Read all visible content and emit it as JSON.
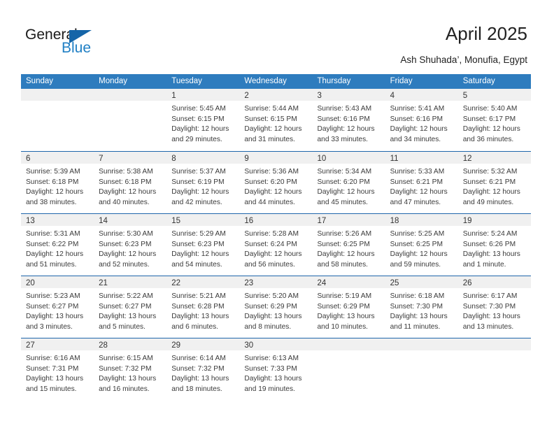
{
  "brand": {
    "name_part1": "General",
    "name_part2": "Blue",
    "triangle_color": "#1565a8",
    "blue_color": "#1f7fc4"
  },
  "header": {
    "title": "April 2025",
    "subtitle": "Ash Shuhada’, Monufia, Egypt"
  },
  "theme": {
    "header_bg": "#2e7cbe",
    "row_border": "#1f66ab",
    "date_strip_bg": "#f0f0f0"
  },
  "weekdays": [
    "Sunday",
    "Monday",
    "Tuesday",
    "Wednesday",
    "Thursday",
    "Friday",
    "Saturday"
  ],
  "weeks": [
    [
      {
        "day": "",
        "blank": true
      },
      {
        "day": "",
        "blank": true
      },
      {
        "day": "1",
        "sunrise": "Sunrise: 5:45 AM",
        "sunset": "Sunset: 6:15 PM",
        "daylight": "Daylight: 12 hours and 29 minutes."
      },
      {
        "day": "2",
        "sunrise": "Sunrise: 5:44 AM",
        "sunset": "Sunset: 6:15 PM",
        "daylight": "Daylight: 12 hours and 31 minutes."
      },
      {
        "day": "3",
        "sunrise": "Sunrise: 5:43 AM",
        "sunset": "Sunset: 6:16 PM",
        "daylight": "Daylight: 12 hours and 33 minutes."
      },
      {
        "day": "4",
        "sunrise": "Sunrise: 5:41 AM",
        "sunset": "Sunset: 6:16 PM",
        "daylight": "Daylight: 12 hours and 34 minutes."
      },
      {
        "day": "5",
        "sunrise": "Sunrise: 5:40 AM",
        "sunset": "Sunset: 6:17 PM",
        "daylight": "Daylight: 12 hours and 36 minutes."
      }
    ],
    [
      {
        "day": "6",
        "sunrise": "Sunrise: 5:39 AM",
        "sunset": "Sunset: 6:18 PM",
        "daylight": "Daylight: 12 hours and 38 minutes."
      },
      {
        "day": "7",
        "sunrise": "Sunrise: 5:38 AM",
        "sunset": "Sunset: 6:18 PM",
        "daylight": "Daylight: 12 hours and 40 minutes."
      },
      {
        "day": "8",
        "sunrise": "Sunrise: 5:37 AM",
        "sunset": "Sunset: 6:19 PM",
        "daylight": "Daylight: 12 hours and 42 minutes."
      },
      {
        "day": "9",
        "sunrise": "Sunrise: 5:36 AM",
        "sunset": "Sunset: 6:20 PM",
        "daylight": "Daylight: 12 hours and 44 minutes."
      },
      {
        "day": "10",
        "sunrise": "Sunrise: 5:34 AM",
        "sunset": "Sunset: 6:20 PM",
        "daylight": "Daylight: 12 hours and 45 minutes."
      },
      {
        "day": "11",
        "sunrise": "Sunrise: 5:33 AM",
        "sunset": "Sunset: 6:21 PM",
        "daylight": "Daylight: 12 hours and 47 minutes."
      },
      {
        "day": "12",
        "sunrise": "Sunrise: 5:32 AM",
        "sunset": "Sunset: 6:21 PM",
        "daylight": "Daylight: 12 hours and 49 minutes."
      }
    ],
    [
      {
        "day": "13",
        "sunrise": "Sunrise: 5:31 AM",
        "sunset": "Sunset: 6:22 PM",
        "daylight": "Daylight: 12 hours and 51 minutes."
      },
      {
        "day": "14",
        "sunrise": "Sunrise: 5:30 AM",
        "sunset": "Sunset: 6:23 PM",
        "daylight": "Daylight: 12 hours and 52 minutes."
      },
      {
        "day": "15",
        "sunrise": "Sunrise: 5:29 AM",
        "sunset": "Sunset: 6:23 PM",
        "daylight": "Daylight: 12 hours and 54 minutes."
      },
      {
        "day": "16",
        "sunrise": "Sunrise: 5:28 AM",
        "sunset": "Sunset: 6:24 PM",
        "daylight": "Daylight: 12 hours and 56 minutes."
      },
      {
        "day": "17",
        "sunrise": "Sunrise: 5:26 AM",
        "sunset": "Sunset: 6:25 PM",
        "daylight": "Daylight: 12 hours and 58 minutes."
      },
      {
        "day": "18",
        "sunrise": "Sunrise: 5:25 AM",
        "sunset": "Sunset: 6:25 PM",
        "daylight": "Daylight: 12 hours and 59 minutes."
      },
      {
        "day": "19",
        "sunrise": "Sunrise: 5:24 AM",
        "sunset": "Sunset: 6:26 PM",
        "daylight": "Daylight: 13 hours and 1 minute."
      }
    ],
    [
      {
        "day": "20",
        "sunrise": "Sunrise: 5:23 AM",
        "sunset": "Sunset: 6:27 PM",
        "daylight": "Daylight: 13 hours and 3 minutes."
      },
      {
        "day": "21",
        "sunrise": "Sunrise: 5:22 AM",
        "sunset": "Sunset: 6:27 PM",
        "daylight": "Daylight: 13 hours and 5 minutes."
      },
      {
        "day": "22",
        "sunrise": "Sunrise: 5:21 AM",
        "sunset": "Sunset: 6:28 PM",
        "daylight": "Daylight: 13 hours and 6 minutes."
      },
      {
        "day": "23",
        "sunrise": "Sunrise: 5:20 AM",
        "sunset": "Sunset: 6:29 PM",
        "daylight": "Daylight: 13 hours and 8 minutes."
      },
      {
        "day": "24",
        "sunrise": "Sunrise: 5:19 AM",
        "sunset": "Sunset: 6:29 PM",
        "daylight": "Daylight: 13 hours and 10 minutes."
      },
      {
        "day": "25",
        "sunrise": "Sunrise: 6:18 AM",
        "sunset": "Sunset: 7:30 PM",
        "daylight": "Daylight: 13 hours and 11 minutes."
      },
      {
        "day": "26",
        "sunrise": "Sunrise: 6:17 AM",
        "sunset": "Sunset: 7:30 PM",
        "daylight": "Daylight: 13 hours and 13 minutes."
      }
    ],
    [
      {
        "day": "27",
        "sunrise": "Sunrise: 6:16 AM",
        "sunset": "Sunset: 7:31 PM",
        "daylight": "Daylight: 13 hours and 15 minutes."
      },
      {
        "day": "28",
        "sunrise": "Sunrise: 6:15 AM",
        "sunset": "Sunset: 7:32 PM",
        "daylight": "Daylight: 13 hours and 16 minutes."
      },
      {
        "day": "29",
        "sunrise": "Sunrise: 6:14 AM",
        "sunset": "Sunset: 7:32 PM",
        "daylight": "Daylight: 13 hours and 18 minutes."
      },
      {
        "day": "30",
        "sunrise": "Sunrise: 6:13 AM",
        "sunset": "Sunset: 7:33 PM",
        "daylight": "Daylight: 13 hours and 19 minutes."
      },
      {
        "day": "",
        "blank": true
      },
      {
        "day": "",
        "blank": true
      },
      {
        "day": "",
        "blank": true
      }
    ]
  ]
}
